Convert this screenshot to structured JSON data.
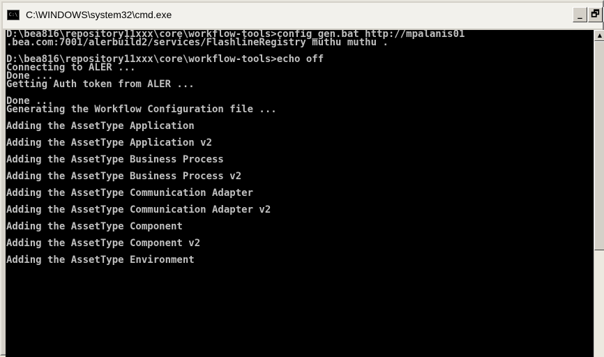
{
  "window": {
    "title": "C:\\WINDOWS\\system32\\cmd.exe",
    "icon_label": "C:\\",
    "buttons": {
      "minimize": "_",
      "maximize": "🗗",
      "close": "x"
    }
  },
  "console": {
    "lines": [
      "D:\\bea816\\repository11xxx\\core\\workflow-tools>config_gen.bat http://mpalanis01",
      ".bea.com:7001/alerbuild2/services/FlashlineRegistry muthu muthu .",
      "",
      "D:\\bea816\\repository11xxx\\core\\workflow-tools>echo off",
      "Connecting to ALER ...",
      "Done ...",
      "Getting Auth token from ALER ...",
      "",
      "Done ...",
      "Generating the Workflow Configuration file ...",
      "",
      "Adding the AssetType Application",
      "",
      "Adding the AssetType Application v2",
      "",
      "Adding the AssetType Business Process",
      "",
      "Adding the AssetType Business Process v2",
      "",
      "Adding the AssetType Communication Adapter",
      "",
      "Adding the AssetType Communication Adapter v2",
      "",
      "Adding the AssetType Component",
      "",
      "Adding the AssetType Component v2",
      "",
      "Adding the AssetType Environment"
    ]
  },
  "scrollbar": {
    "up_arrow": "▲"
  }
}
